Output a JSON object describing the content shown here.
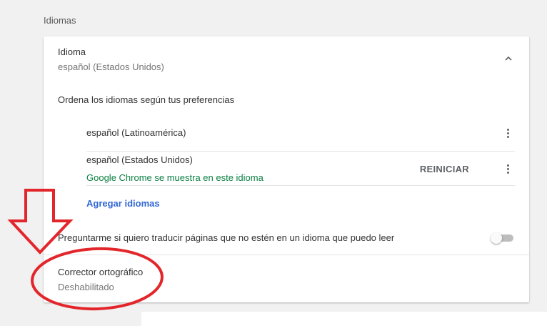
{
  "section": {
    "title": "Idiomas"
  },
  "language": {
    "title": "Idioma",
    "current": "español (Estados Unidos)",
    "order_label": "Ordena los idiomas según tus preferencias",
    "items": [
      {
        "name": "español (Latinoamérica)"
      },
      {
        "name": "español (Estados Unidos)",
        "note": "Google Chrome se muestra en este idioma",
        "action": "REINICIAR"
      }
    ],
    "add_label": "Agregar idiomas"
  },
  "translate": {
    "label": "Preguntarme si quiero traducir páginas que no estén en un idioma que puedo leer",
    "enabled": false
  },
  "spellcheck": {
    "title": "Corrector ortográfico",
    "status": "Deshabilitado"
  },
  "colors": {
    "link": "#3367d6",
    "note_green": "#0b8043",
    "annotation_red": "#e3262b"
  },
  "icons": [
    "chevron-up-icon",
    "more-vert-icon",
    "down-arrow-annotation",
    "circle-annotation"
  ]
}
